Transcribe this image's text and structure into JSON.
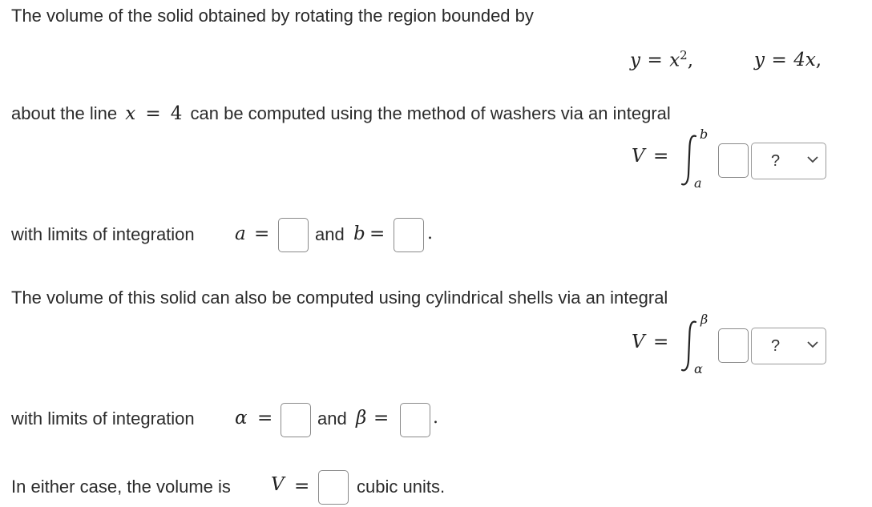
{
  "intro": "The volume of the solid obtained by rotating the region bounded by",
  "eq1_lhs": "y",
  "eq1_eq": "=",
  "eq1_rhs": "x",
  "eq1_exp": "2",
  "eq1_comma": ",",
  "eq2_lhs": "y",
  "eq2_eq": "=",
  "eq2_rhs": "4x",
  "eq2_comma": ",",
  "washers_text_a": "about the line",
  "washers_line_var": "x",
  "washers_line_eq": "=",
  "washers_line_val": "4",
  "washers_text_b": "can be computed using the method of washers via an integral",
  "washers_integral": {
    "lhs": "V",
    "eq": "=",
    "upper": "b",
    "lower": "a",
    "dropdown_value": "?"
  },
  "washers_limits": {
    "prefix": "with limits of integration",
    "var1": "a",
    "eq": "=",
    "and": "and",
    "var2": "b",
    "period": "."
  },
  "shells_text": "The volume of this solid can also be computed using cylindrical shells via an integral",
  "shells_integral": {
    "lhs": "V",
    "eq": "=",
    "upper": "β",
    "lower": "α",
    "dropdown_value": "?"
  },
  "shells_limits": {
    "prefix": "with limits of integration",
    "var1": "α",
    "eq": "=",
    "and": "and",
    "var2": "β",
    "period": "."
  },
  "final": {
    "prefix": "In either case, the volume is",
    "var": "V",
    "eq": "=",
    "suffix": "cubic units."
  }
}
